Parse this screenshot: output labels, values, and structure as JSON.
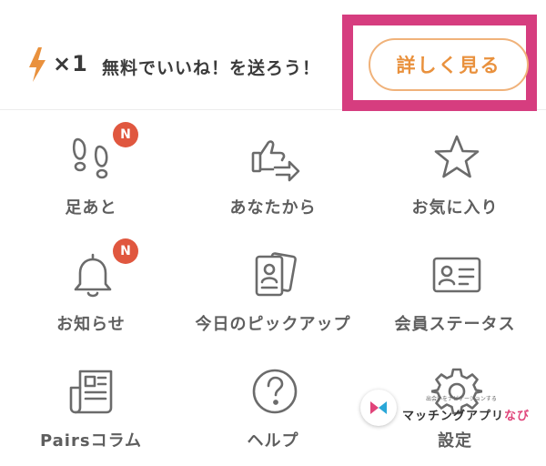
{
  "banner": {
    "multiplier": "×1",
    "promo_text": "無料でいいね！を送ろう！",
    "details_button": "詳しく見る"
  },
  "colors": {
    "accent_orange": "#e9913d",
    "highlight_pink": "#d63d7f",
    "badge_red": "#e0573f"
  },
  "menu": {
    "items": [
      {
        "label": "足あと",
        "icon": "footprints-icon",
        "badge": "N"
      },
      {
        "label": "あなたから",
        "icon": "thumbs-up-send-icon",
        "badge": ""
      },
      {
        "label": "お気に入り",
        "icon": "star-icon",
        "badge": ""
      },
      {
        "label": "お知らせ",
        "icon": "bell-icon",
        "badge": "N"
      },
      {
        "label": "今日のピックアップ",
        "icon": "profile-cards-icon",
        "badge": ""
      },
      {
        "label": "会員ステータス",
        "icon": "id-card-icon",
        "badge": ""
      },
      {
        "label": "Pairsコラム",
        "icon": "newspaper-icon",
        "badge": ""
      },
      {
        "label": "ヘルプ",
        "icon": "question-icon",
        "badge": ""
      },
      {
        "label": "設定",
        "icon": "gear-icon",
        "badge": ""
      }
    ]
  },
  "watermark": {
    "tagline": "出会いをナビゲーションする",
    "name_main": "マッチングアプリ",
    "name_accent": "なび"
  }
}
